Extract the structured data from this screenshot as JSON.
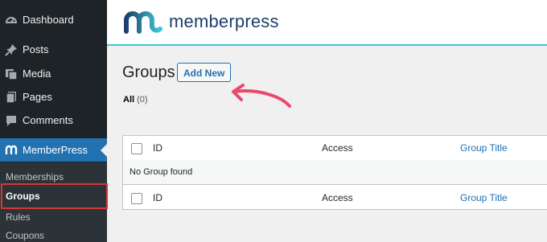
{
  "sidebar": {
    "items": [
      {
        "label": "Dashboard",
        "icon": "dashboard-icon"
      },
      {
        "label": "Posts",
        "icon": "pin-icon"
      },
      {
        "label": "Media",
        "icon": "media-icon"
      },
      {
        "label": "Pages",
        "icon": "pages-icon"
      },
      {
        "label": "Comments",
        "icon": "comment-icon"
      },
      {
        "label": "MemberPress",
        "icon": "memberpress-icon",
        "active": true
      }
    ],
    "submenu": [
      "Memberships",
      "Groups",
      "Rules",
      "Coupons"
    ],
    "current_submenu": "Groups",
    "highlight_color": "#d63638"
  },
  "header": {
    "logo_text": "memberpress",
    "accent_color": "#3cc9d6"
  },
  "page": {
    "title": "Groups",
    "add_new_label": "Add New",
    "annotation": "red-arrow-icon"
  },
  "filters": {
    "all_label": "All",
    "all_count": "(0)"
  },
  "table": {
    "columns": {
      "id": "ID",
      "access": "Access",
      "title": "Group Title"
    },
    "empty_message": "No Group found"
  },
  "colors": {
    "sidebar_bg": "#1d2327",
    "active_bg": "#2271b1",
    "link": "#2271b1"
  }
}
